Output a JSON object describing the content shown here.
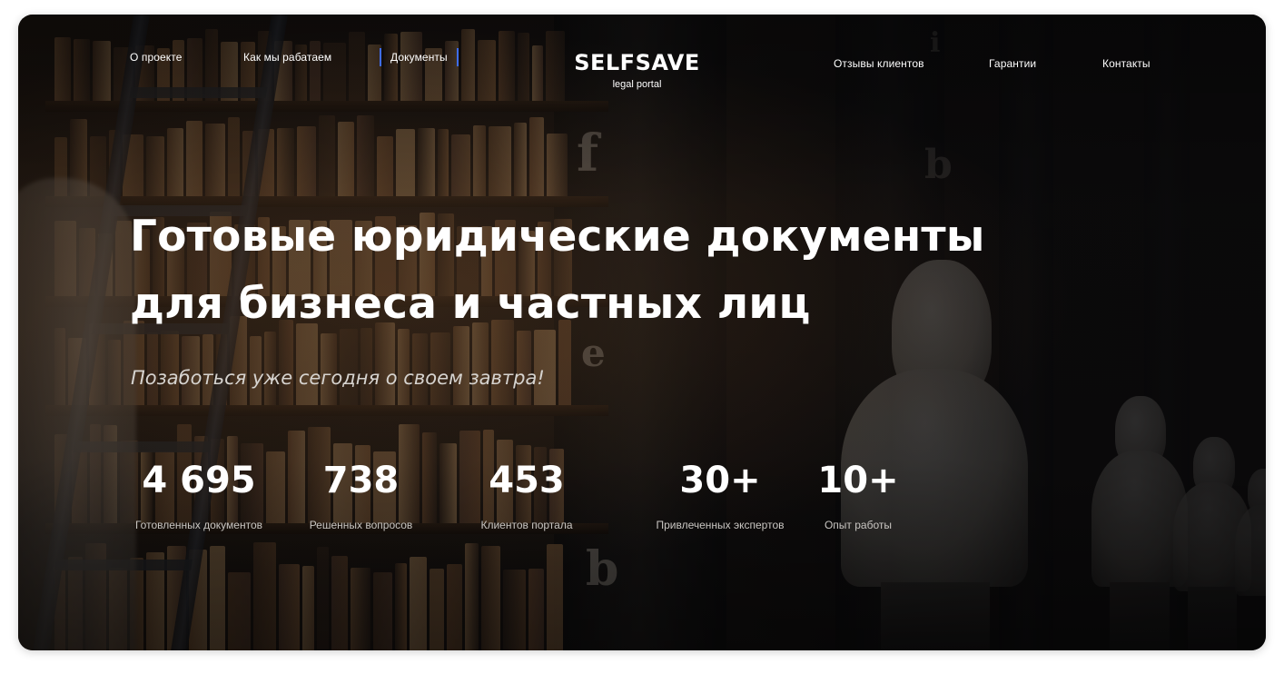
{
  "nav": {
    "left": [
      {
        "label": "О проекте"
      },
      {
        "label": "Как мы рабатаем"
      },
      {
        "label": "Документы"
      }
    ],
    "right": [
      {
        "label": "Отзывы клиентов"
      },
      {
        "label": "Гарантии"
      },
      {
        "label": "Контакты"
      }
    ],
    "active_color": "#3f6df0"
  },
  "logo": {
    "title": "SELFSAVE",
    "subtitle": "legal portal"
  },
  "hero": {
    "title_line1": "Готовые юридические документы",
    "title_line2": "для бизнеса и частных лиц",
    "tagline": "Позаботься уже сегодня о своем завтра!"
  },
  "stats": [
    {
      "value": "4 695",
      "label": "Готовленных документов"
    },
    {
      "value": "738",
      "label": "Решенных вопросов"
    },
    {
      "value": "453",
      "label": "Клиентов портала"
    },
    {
      "value": "30+",
      "label": "Привлеченных экспертов"
    },
    {
      "value": "10+",
      "label": "Опыт работы"
    }
  ],
  "background": {
    "shelf_glyphs": [
      "f",
      "b",
      "e",
      "b",
      "i"
    ]
  }
}
